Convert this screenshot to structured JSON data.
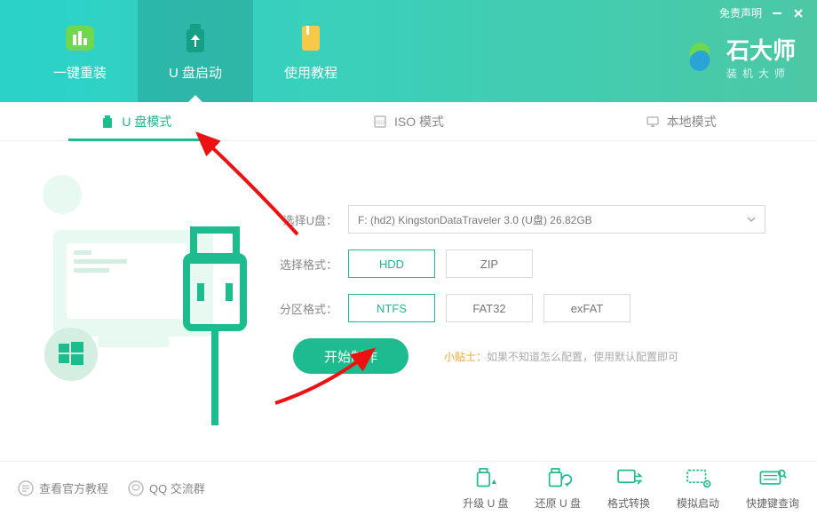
{
  "header": {
    "tabs": [
      {
        "label": "一键重装"
      },
      {
        "label": "U 盘启动"
      },
      {
        "label": "使用教程"
      }
    ],
    "disclaimer": "免责声明",
    "brand_title": "石大师",
    "brand_sub": "装机大师"
  },
  "tabs2": [
    {
      "label": "U 盘模式"
    },
    {
      "label": "ISO 模式"
    },
    {
      "label": "本地模式"
    }
  ],
  "form": {
    "select_u_label": "选择U盘：",
    "select_u_value": "F: (hd2) KingstonDataTraveler 3.0 (U盘) 26.82GB",
    "select_format_label": "选择格式：",
    "format_opts": [
      "HDD",
      "ZIP"
    ],
    "partition_label": "分区格式：",
    "partition_opts": [
      "NTFS",
      "FAT32",
      "exFAT"
    ],
    "start_label": "开始制作",
    "tip_label": "小贴士：",
    "tip_text": "如果不知道怎么配置，使用默认配置即可"
  },
  "footer": {
    "left": [
      {
        "label": "查看官方教程"
      },
      {
        "label": "QQ 交流群"
      }
    ],
    "right": [
      {
        "label": "升级 U 盘"
      },
      {
        "label": "还原 U 盘"
      },
      {
        "label": "格式转换"
      },
      {
        "label": "模拟启动"
      },
      {
        "label": "快捷键查询"
      }
    ]
  }
}
